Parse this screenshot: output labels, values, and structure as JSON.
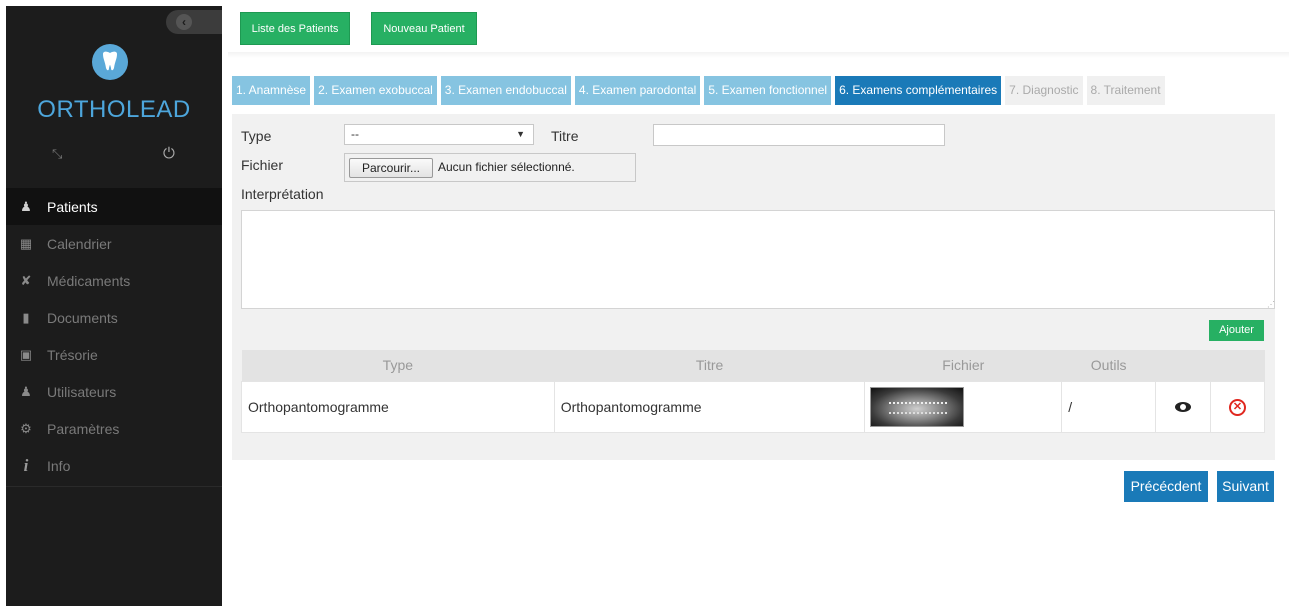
{
  "sidebar": {
    "brand": "ORTHOLEAD",
    "items": [
      {
        "label": "Patients",
        "icon": "patients-icon",
        "glyph": "♟"
      },
      {
        "label": "Calendrier",
        "icon": "calendar-icon",
        "glyph": "▦"
      },
      {
        "label": "Médicaments",
        "icon": "pill-icon",
        "glyph": "✘"
      },
      {
        "label": "Documents",
        "icon": "document-icon",
        "glyph": "▮"
      },
      {
        "label": "Trésorie",
        "icon": "cash-icon",
        "glyph": "▣"
      },
      {
        "label": "Utilisateurs",
        "icon": "user-icon",
        "glyph": "♟"
      },
      {
        "label": "Paramètres",
        "icon": "settings-icon",
        "glyph": "⚙"
      },
      {
        "label": "Info",
        "icon": "info-icon",
        "glyph": "i"
      }
    ],
    "active_index": 0
  },
  "toolbar": {
    "liste_label": "Liste des Patients",
    "nouveau_label": "Nouveau Patient"
  },
  "tabs": [
    {
      "label": "1. Anamnèse",
      "state": "normal"
    },
    {
      "label": "2. Examen exobuccal",
      "state": "normal"
    },
    {
      "label": "3. Examen endobuccal",
      "state": "normal"
    },
    {
      "label": "4. Examen parodontal",
      "state": "normal"
    },
    {
      "label": "5. Examen fonctionnel",
      "state": "normal"
    },
    {
      "label": "6. Examens complémentaires",
      "state": "active"
    },
    {
      "label": "7. Diagnostic",
      "state": "disabled"
    },
    {
      "label": "8. Traitement",
      "state": "disabled"
    }
  ],
  "form": {
    "type_label": "Type",
    "type_value": "--",
    "titre_label": "Titre",
    "titre_value": "",
    "fichier_label": "Fichier",
    "browse_label": "Parcourir...",
    "file_status": "Aucun fichier sélectionné.",
    "interpretation_label": "Interprétation",
    "interpretation_value": "",
    "add_label": "Ajouter"
  },
  "table": {
    "columns": [
      "Type",
      "Titre",
      "Fichier",
      "Outils"
    ],
    "rows": [
      {
        "type": "Orthopantomogramme",
        "titre": "Orthopantomogramme",
        "outils": "/"
      }
    ]
  },
  "nav": {
    "prev_label": "Précécdent",
    "next_label": "Suivant"
  },
  "colors": {
    "sidebar_bg": "#1c1c1c",
    "brand": "#4da6dc",
    "green": "#27b063",
    "tab_light": "#86c4e1",
    "tab_active": "#1a7ab8",
    "danger": "#e0271f"
  }
}
